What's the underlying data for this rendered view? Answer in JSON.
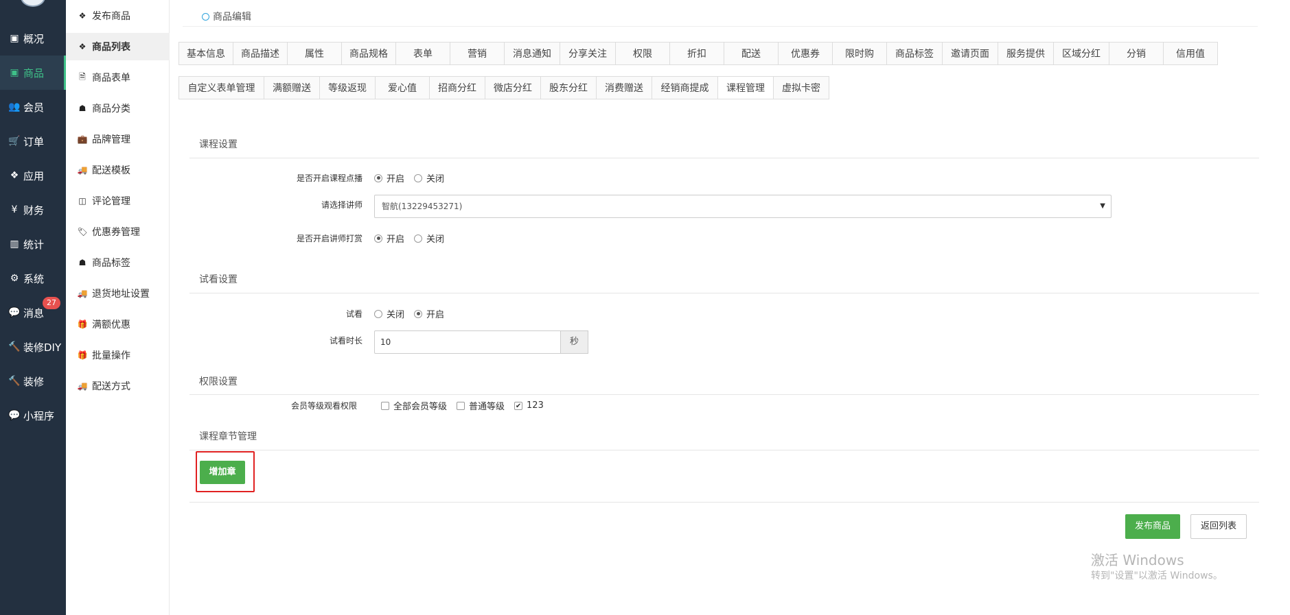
{
  "nav": {
    "items": [
      {
        "label": "概况",
        "icon": "dashboard-icon",
        "glyph": "▣"
      },
      {
        "label": "商品",
        "icon": "product-icon",
        "glyph": "▣",
        "active": true
      },
      {
        "label": "会员",
        "icon": "users-icon",
        "glyph": "👥"
      },
      {
        "label": "订单",
        "icon": "cart-icon",
        "glyph": "🛒"
      },
      {
        "label": "应用",
        "icon": "apps-icon",
        "glyph": "❖"
      },
      {
        "label": "财务",
        "icon": "yen-icon",
        "glyph": "¥"
      },
      {
        "label": "统计",
        "icon": "bar-chart-icon",
        "glyph": "▥"
      },
      {
        "label": "系统",
        "icon": "gears-icon",
        "glyph": "⚙"
      },
      {
        "label": "消息",
        "icon": "comment-icon",
        "glyph": "💬",
        "badge": "27"
      },
      {
        "label": "装修DIY",
        "icon": "hammer-icon",
        "glyph": "🔨"
      },
      {
        "label": "装修",
        "icon": "hammer-icon",
        "glyph": "🔨"
      },
      {
        "label": "小程序",
        "icon": "wechat-icon",
        "glyph": "💬"
      }
    ]
  },
  "subnav": {
    "items": [
      {
        "label": "发布商品",
        "icon": "cubes-icon",
        "glyph": "❖"
      },
      {
        "label": "商品列表",
        "icon": "cubes-icon",
        "glyph": "❖",
        "active": true
      },
      {
        "label": "商品表单",
        "icon": "file-excel-icon",
        "glyph": "🗎"
      },
      {
        "label": "商品分类",
        "icon": "sitemap-icon",
        "glyph": "☗"
      },
      {
        "label": "品牌管理",
        "icon": "briefcase-icon",
        "glyph": "💼"
      },
      {
        "label": "配送模板",
        "icon": "truck-icon",
        "glyph": "🚚"
      },
      {
        "label": "评论管理",
        "icon": "columns-icon",
        "glyph": "◫"
      },
      {
        "label": "优惠券管理",
        "icon": "tags-icon",
        "glyph": "🏷"
      },
      {
        "label": "商品标签",
        "icon": "sitemap-icon",
        "glyph": "☗"
      },
      {
        "label": "退货地址设置",
        "icon": "truck-icon",
        "glyph": "🚚"
      },
      {
        "label": "满额优惠",
        "icon": "gift-icon",
        "glyph": "🎁"
      },
      {
        "label": "批量操作",
        "icon": "gift-icon",
        "glyph": "🎁"
      },
      {
        "label": "配送方式",
        "icon": "truck-icon",
        "glyph": "🚚"
      }
    ]
  },
  "page": {
    "title": "商品编辑"
  },
  "tabs_row1": [
    {
      "label": "基本信息",
      "w": 80
    },
    {
      "label": "商品描述",
      "w": 80
    },
    {
      "label": "属性",
      "w": 80
    },
    {
      "label": "商品规格",
      "w": 80
    },
    {
      "label": "表单",
      "w": 80
    },
    {
      "label": "营销",
      "w": 80
    },
    {
      "label": "消息通知",
      "w": 82
    },
    {
      "label": "分享关注",
      "w": 82
    },
    {
      "label": "权限",
      "w": 80
    },
    {
      "label": "折扣",
      "w": 80
    },
    {
      "label": "配送",
      "w": 80
    },
    {
      "label": "优惠券",
      "w": 80
    },
    {
      "label": "限时购",
      "w": 80
    },
    {
      "label": "商品标签",
      "w": 82
    },
    {
      "label": "邀请页面",
      "w": 82
    },
    {
      "label": "服务提供",
      "w": 82
    },
    {
      "label": "区域分红",
      "w": 82
    },
    {
      "label": "分销",
      "w": 80
    },
    {
      "label": "信用值",
      "w": 80
    }
  ],
  "tabs_row2": [
    {
      "label": "自定义表单管理",
      "w": 125
    },
    {
      "label": "满额赠送",
      "w": 82
    },
    {
      "label": "等级返现",
      "w": 82
    },
    {
      "label": "爱心值",
      "w": 80
    },
    {
      "label": "招商分红",
      "w": 82
    },
    {
      "label": "微店分红",
      "w": 82
    },
    {
      "label": "股东分红",
      "w": 82
    },
    {
      "label": "消费赠送",
      "w": 82
    },
    {
      "label": "经销商提成",
      "w": 97
    },
    {
      "label": "课程管理",
      "w": 82,
      "active": true
    },
    {
      "label": "虚拟卡密",
      "w": 82
    }
  ],
  "course": {
    "section_title": "课程设置",
    "enable_label": "是否开启课程点播",
    "enable_on": "开启",
    "enable_off": "关闭",
    "lecturer_label": "请选择讲师",
    "lecturer_value": "智航(13229453271)",
    "reward_label": "是否开启讲师打赏",
    "reward_on": "开启",
    "reward_off": "关闭"
  },
  "trial": {
    "section_title": "试看设置",
    "trial_label": "试看",
    "trial_off": "关闭",
    "trial_on": "开启",
    "duration_label": "试看时长",
    "duration_value": "10",
    "duration_unit": "秒"
  },
  "permission": {
    "section_title": "权限设置",
    "level_label": "会员等级观看权限",
    "options": [
      "全部会员等级",
      "普通等级",
      "123"
    ]
  },
  "chapter": {
    "section_title": "课程章节管理",
    "add_button": "增加章"
  },
  "footer": {
    "publish_button": "发布商品",
    "back_button": "返回列表"
  },
  "watermark": {
    "line1": "激活 Windows",
    "line2": "转到\"设置\"以激活 Windows。"
  },
  "colors": {
    "nav_bg": "#233040",
    "accent": "#3fc088",
    "green_button": "#4cae4c",
    "badge": "#e8514f",
    "highlight": "#e02020"
  }
}
